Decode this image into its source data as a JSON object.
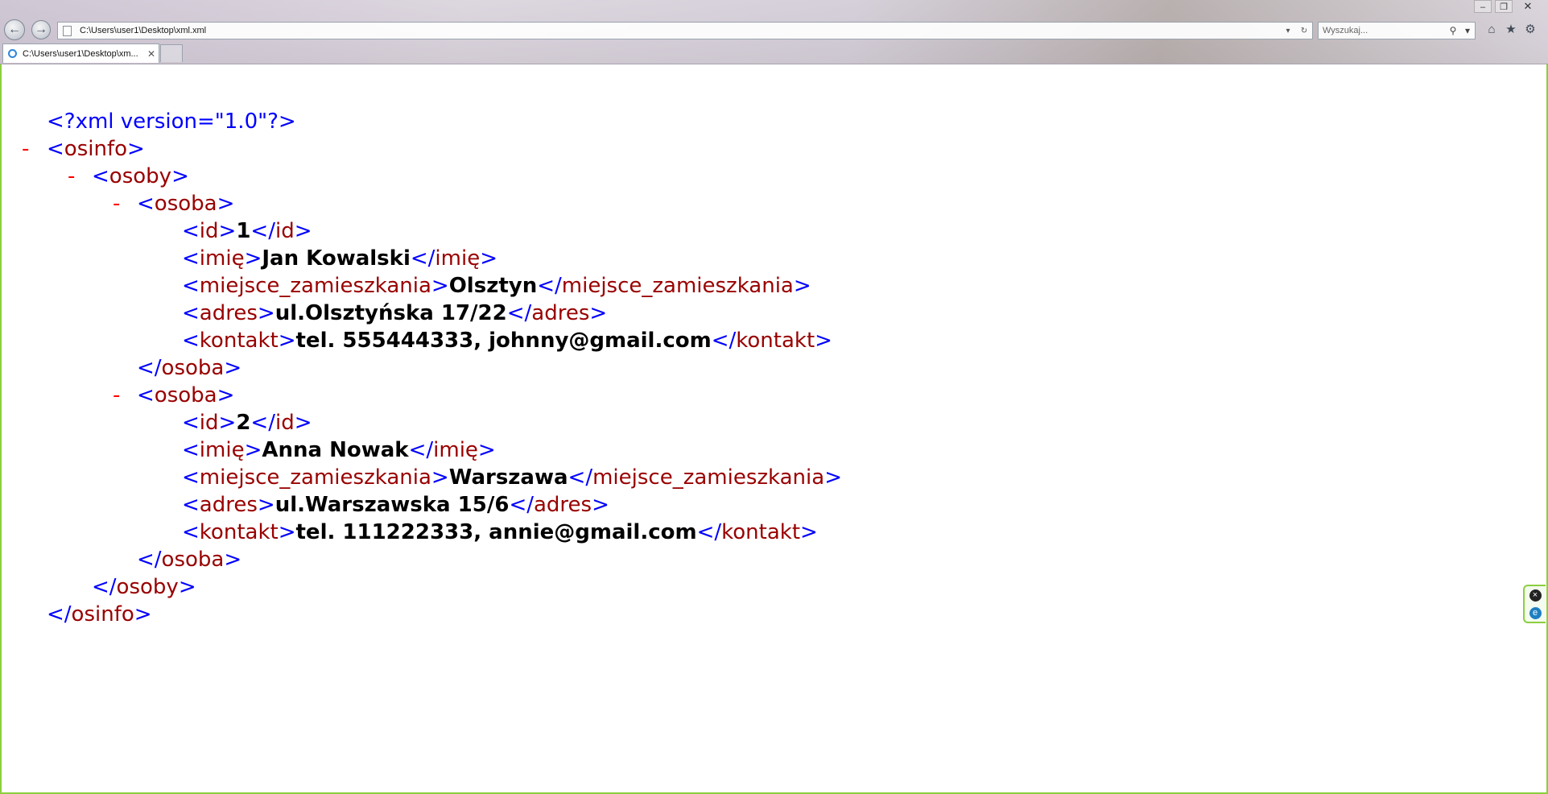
{
  "browser": {
    "address": "C:\\Users\\user1\\Desktop\\xml.xml",
    "search_placeholder": "Wyszukaj...",
    "tab_title": "C:\\Users\\user1\\Desktop\\xm...",
    "icons": {
      "back": "back-arrow-icon",
      "forward": "forward-arrow-icon",
      "refresh": "refresh-icon",
      "search": "search-icon",
      "home": "home-icon",
      "favorites": "star-icon",
      "tools": "gear-icon"
    },
    "window_controls": [
      "minimize",
      "restore",
      "close"
    ]
  },
  "xml": {
    "declaration": "<?xml version=\"1.0\"?>",
    "root": "osinfo",
    "container": "osoby",
    "element": "osoba",
    "fields": {
      "id": "id",
      "name": "imię",
      "city": "miejsce_zamieszkania",
      "address": "adres",
      "contact": "kontakt"
    },
    "persons": [
      {
        "id": "1",
        "name": "Jan Kowalski",
        "city": "Olsztyn",
        "address": "ul.Olsztyńska 17/22",
        "contact": "tel. 555444333, johnny@gmail.com"
      },
      {
        "id": "2",
        "name": "Anna Nowak",
        "city": "Warszawa",
        "address": "ul.Warszawska 15/6",
        "contact": "tel. 111222333, annie@gmail.com"
      }
    ],
    "toggle_symbol": "-"
  },
  "colors": {
    "markup_bracket": "#0000ff",
    "tag_name": "#990000",
    "value_text": "#000000",
    "collapse_toggle": "#ff0000",
    "window_border": "#8ccf3f"
  }
}
